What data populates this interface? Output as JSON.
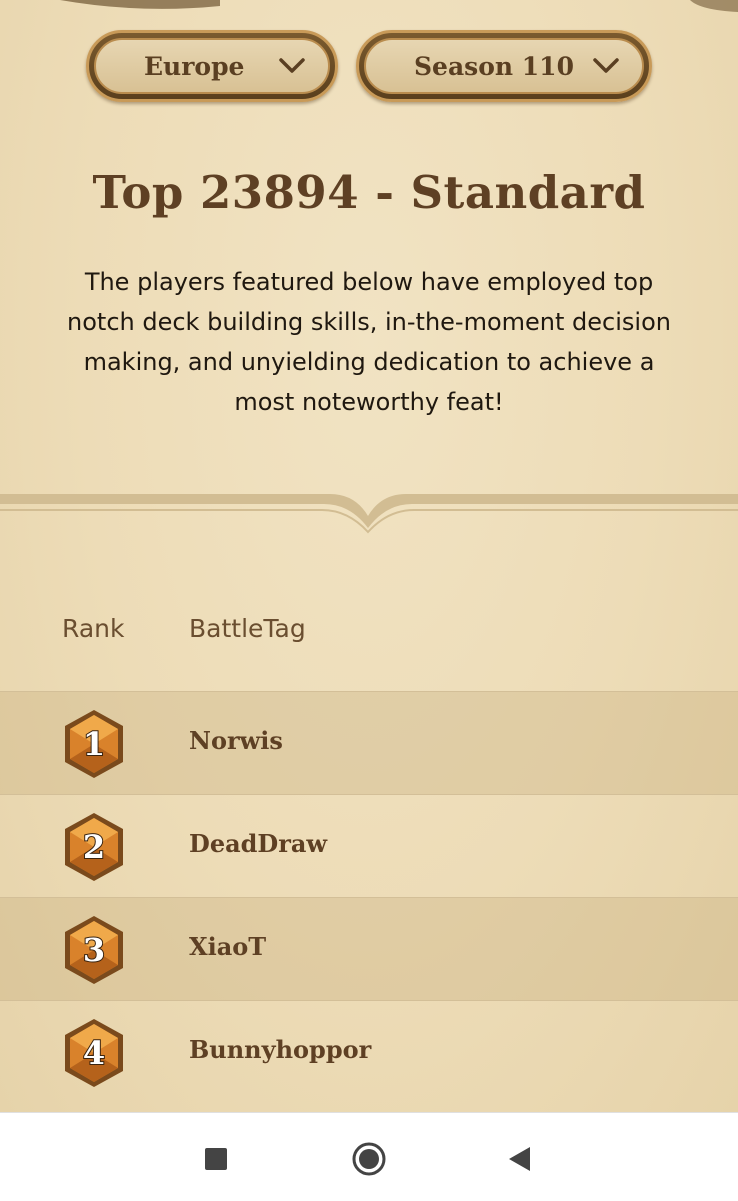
{
  "filters": {
    "region": "Europe",
    "season": "Season 110"
  },
  "leaderboard": {
    "title": "Top 23894 - Standard",
    "description": "The players featured below have employed top notch deck building skills, in-the-moment decision making, and unyielding dedication to achieve a most noteworthy feat!",
    "columns": {
      "rank": "Rank",
      "battletag": "BattleTag"
    },
    "rows": [
      {
        "rank": "1",
        "battletag": "Norwis"
      },
      {
        "rank": "2",
        "battletag": "DeadDraw"
      },
      {
        "rank": "3",
        "battletag": "XiaoT"
      },
      {
        "rank": "4",
        "battletag": "Bunnyhoppor"
      }
    ]
  },
  "nav": {
    "icons": [
      "recents-square-icon",
      "home-circle-icon",
      "back-triangle-icon"
    ]
  },
  "colors": {
    "heading": "#5e4024",
    "parchment": "#ecdcb8",
    "badge_orange": "#d9822b"
  }
}
